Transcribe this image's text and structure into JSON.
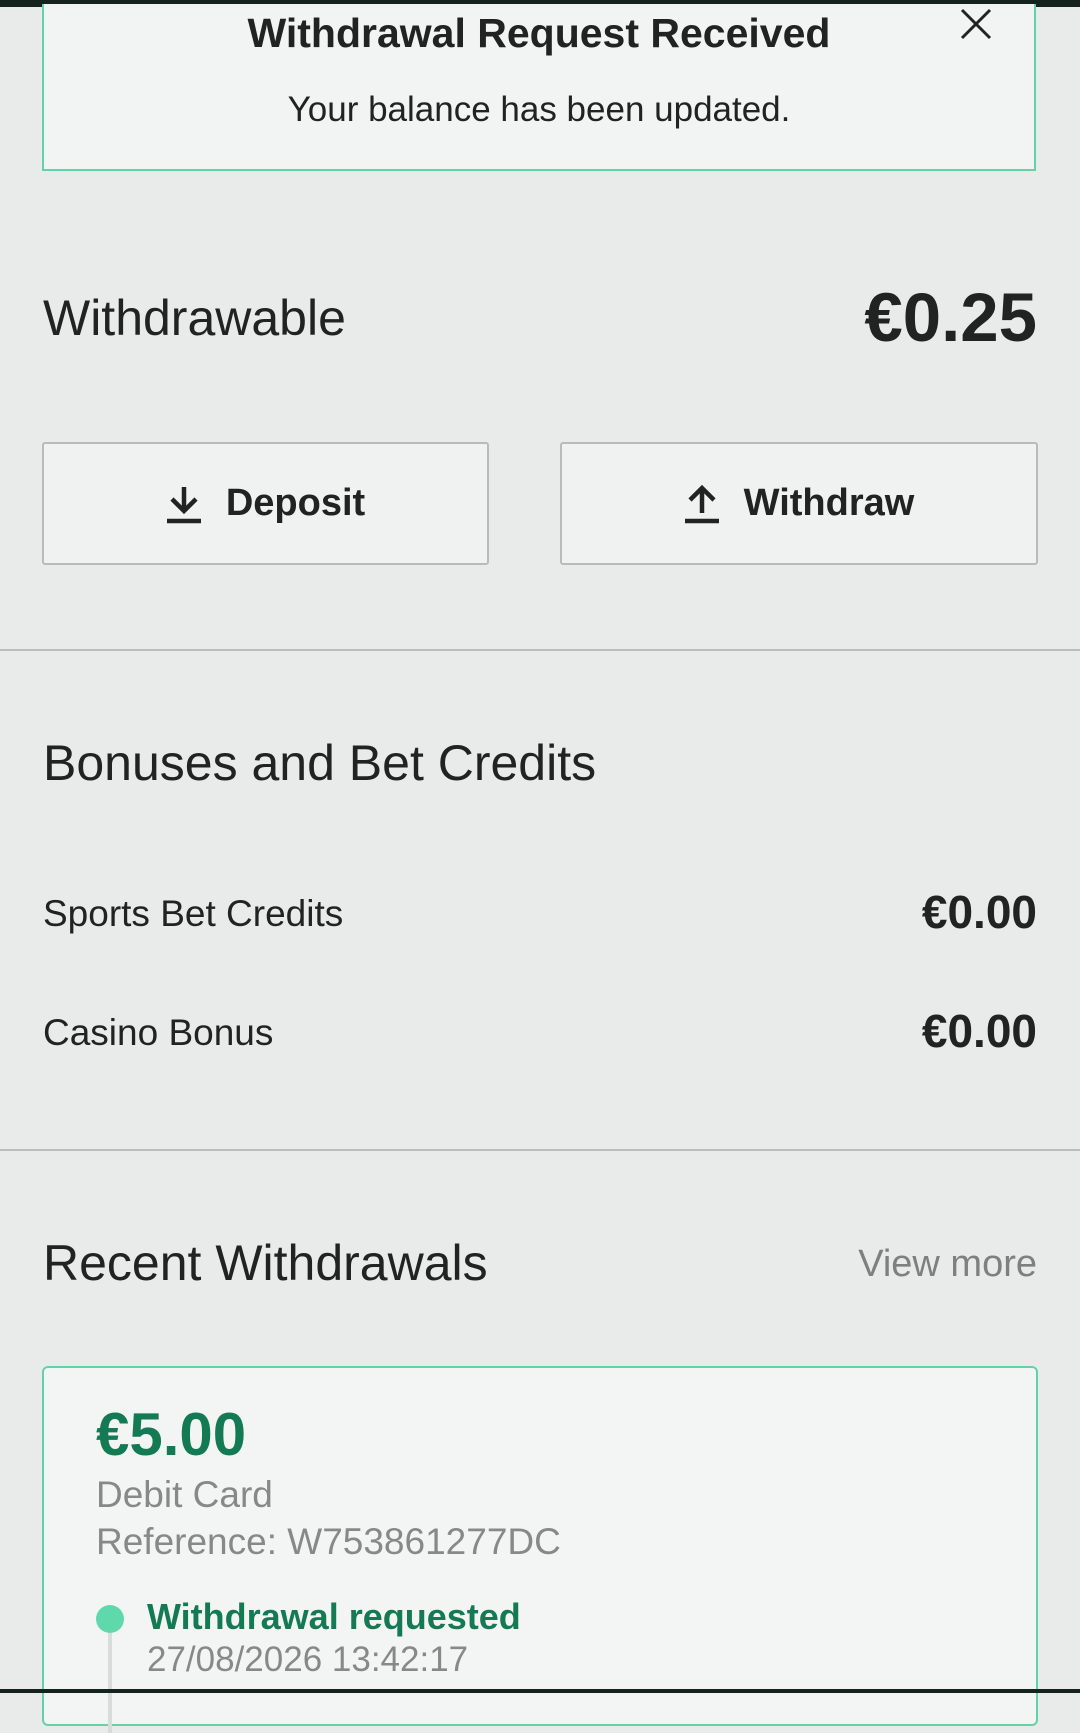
{
  "notice": {
    "title": "Withdrawal Request Received",
    "message": "Your balance has been updated.",
    "close_icon": "close-icon"
  },
  "balance": {
    "label": "Withdrawable",
    "value": "€0.25"
  },
  "actions": {
    "deposit_label": "Deposit",
    "deposit_icon": "download-icon",
    "withdraw_label": "Withdraw",
    "withdraw_icon": "upload-icon"
  },
  "bonuses": {
    "title": "Bonuses and Bet Credits",
    "items": [
      {
        "label": "Sports Bet Credits",
        "value": "€0.00"
      },
      {
        "label": "Casino Bonus",
        "value": "€0.00"
      }
    ]
  },
  "recent_withdrawals": {
    "title": "Recent Withdrawals",
    "view_more": "View more",
    "items": [
      {
        "amount": "€5.00",
        "method": "Debit Card",
        "reference": "Reference: W753861277DC",
        "status": "Withdrawal requested",
        "timestamp": "27/08/2026 13:42:17"
      }
    ]
  },
  "colors": {
    "accent_green": "#147a54",
    "border_green": "#63d2a8",
    "timeline_dot": "#5fd9ab",
    "background": "#e9ebea"
  }
}
